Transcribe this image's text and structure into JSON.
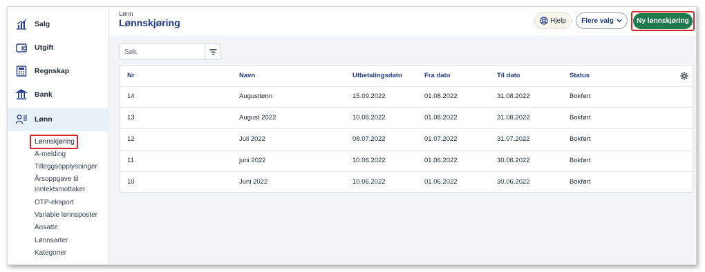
{
  "sidebar": {
    "items": [
      {
        "label": "Salg"
      },
      {
        "label": "Utgift"
      },
      {
        "label": "Regnskap"
      },
      {
        "label": "Bank"
      },
      {
        "label": "Lønn"
      }
    ],
    "subitems": [
      {
        "label": "Lønnskjøring"
      },
      {
        "label": "A-melding"
      },
      {
        "label": "Tilleggsopplysninger"
      },
      {
        "label": "Årsoppgave til"
      },
      {
        "label": "inntektsmottaker"
      },
      {
        "label": "OTP-eksport"
      },
      {
        "label": "Variable lønnsposter"
      },
      {
        "label": "Ansatte"
      },
      {
        "label": "Lønnsarter"
      },
      {
        "label": "Kategorier"
      }
    ]
  },
  "header": {
    "breadcrumb": "Lønn",
    "title": "Lønnskjøring",
    "help_label": "Hjelp",
    "more_label": "Flere valg",
    "new_label": "Ny lønnskjøring"
  },
  "search": {
    "placeholder": "Søk"
  },
  "table": {
    "columns": [
      "Nr",
      "Navn",
      "Utbetalingsdato",
      "Fra dato",
      "Til dato",
      "Status"
    ],
    "rows": [
      [
        "14",
        "Augustlønn",
        "15.09.2022",
        "01.08.2022",
        "31.08.2022",
        "Bokført"
      ],
      [
        "13",
        "August 2022",
        "10.08.2022",
        "01.08.2022",
        "31.08.2022",
        "Bokført"
      ],
      [
        "12",
        "Juli 2022",
        "08.07.2022",
        "01.07.2022",
        "31.07.2022",
        "Bokført"
      ],
      [
        "11",
        "juni 2022",
        "10.06.2022",
        "01.06.2022",
        "30.06.2022",
        "Bokført"
      ],
      [
        "10",
        "Juni 2022",
        "10.06.2022",
        "01.06.2022",
        "30.06.2022",
        "Bokført"
      ]
    ]
  },
  "colors": {
    "accent_green": "#1f7a4d",
    "title_blue": "#1e3a8a",
    "highlight_red": "#d62828",
    "active_nav_bg": "#e7f1f7"
  }
}
